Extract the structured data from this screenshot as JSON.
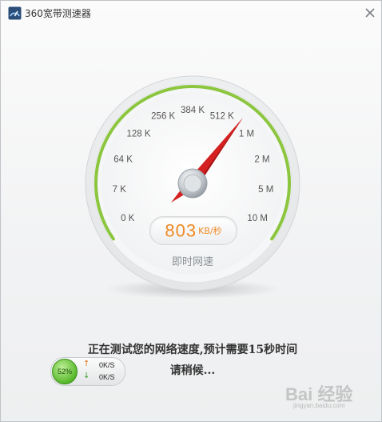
{
  "window": {
    "title": "360宽带测速器",
    "close_icon": "close-icon",
    "app_icon": "speedometer-icon"
  },
  "gauge": {
    "scale_labels": [
      "0 K",
      "7 K",
      "64 K",
      "128 K",
      "256 K",
      "384 K",
      "512 K",
      "1 M",
      "2 M",
      "5 M",
      "10 M"
    ],
    "current_speed": "803",
    "current_unit": "KB/秒",
    "caption": "即时网速",
    "accent_color": "#8cc63f",
    "speed_color": "#f08a24",
    "needle_color": "#d42020"
  },
  "status": {
    "line1": "正在测试您的网络速度,预计需要15秒时间",
    "line2": "请稍候..."
  },
  "mini_widget": {
    "progress_text": "52%",
    "progress_value": 0.52,
    "upload_speed": "0K/S",
    "download_speed": "0K/S"
  },
  "watermark": {
    "brand": "Bai  经验",
    "url": "jingyan.baidu.com"
  }
}
